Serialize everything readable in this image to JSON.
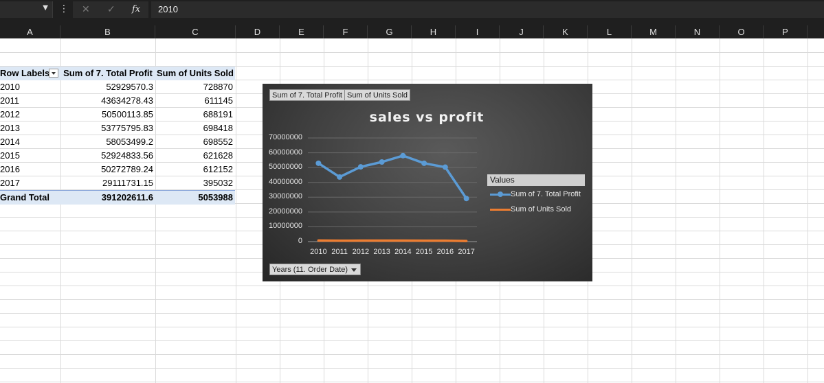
{
  "formula_bar": {
    "fx_label": "fx",
    "value": "2010",
    "cancel_icon": "close-icon",
    "enter_icon": "check-icon"
  },
  "columns": [
    "A",
    "B",
    "C",
    "D",
    "E",
    "F",
    "G",
    "H",
    "I",
    "J",
    "K",
    "L",
    "M",
    "N",
    "O",
    "P"
  ],
  "pivot": {
    "headers": [
      "Row Labels",
      "Sum of 7. Total Profit",
      "Sum of Units Sold"
    ],
    "rows": [
      {
        "label": "2010",
        "profit": "52929570.3",
        "units": "728870"
      },
      {
        "label": "2011",
        "profit": "43634278.43",
        "units": "611145"
      },
      {
        "label": "2012",
        "profit": "50500113.85",
        "units": "688191"
      },
      {
        "label": "2013",
        "profit": "53775795.83",
        "units": "698418"
      },
      {
        "label": "2014",
        "profit": "58053499.2",
        "units": "698552"
      },
      {
        "label": "2015",
        "profit": "52924833.56",
        "units": "621628"
      },
      {
        "label": "2016",
        "profit": "50272789.24",
        "units": "612152"
      },
      {
        "label": "2017",
        "profit": "29111731.15",
        "units": "395032"
      }
    ],
    "total": {
      "label": "Grand Total",
      "profit": "391202611.6",
      "units": "5053988"
    }
  },
  "chart_data": {
    "type": "line",
    "title": "sales vs profit",
    "field_buttons": [
      "Sum of 7. Total Profit",
      "Sum of Units Sold"
    ],
    "axis_field_button": "Years (11. Order Date)",
    "legend_title": "Values",
    "legend_position": "right",
    "categories": [
      "2010",
      "2011",
      "2012",
      "2013",
      "2014",
      "2015",
      "2016",
      "2017"
    ],
    "y_ticks": [
      "70000000",
      "60000000",
      "50000000",
      "40000000",
      "30000000",
      "20000000",
      "10000000",
      "0"
    ],
    "ylim": [
      0,
      70000000
    ],
    "grid": true,
    "series": [
      {
        "name": "Sum of 7. Total Profit",
        "color": "#5b9bd5",
        "values": [
          52929570.3,
          43634278.43,
          50500113.85,
          53775795.83,
          58053499.2,
          52924833.56,
          50272789.24,
          29111731.15
        ]
      },
      {
        "name": "Sum of Units Sold",
        "color": "#ed7d31",
        "values": [
          728870,
          611145,
          688191,
          698418,
          698552,
          621628,
          612152,
          395032
        ]
      }
    ]
  }
}
